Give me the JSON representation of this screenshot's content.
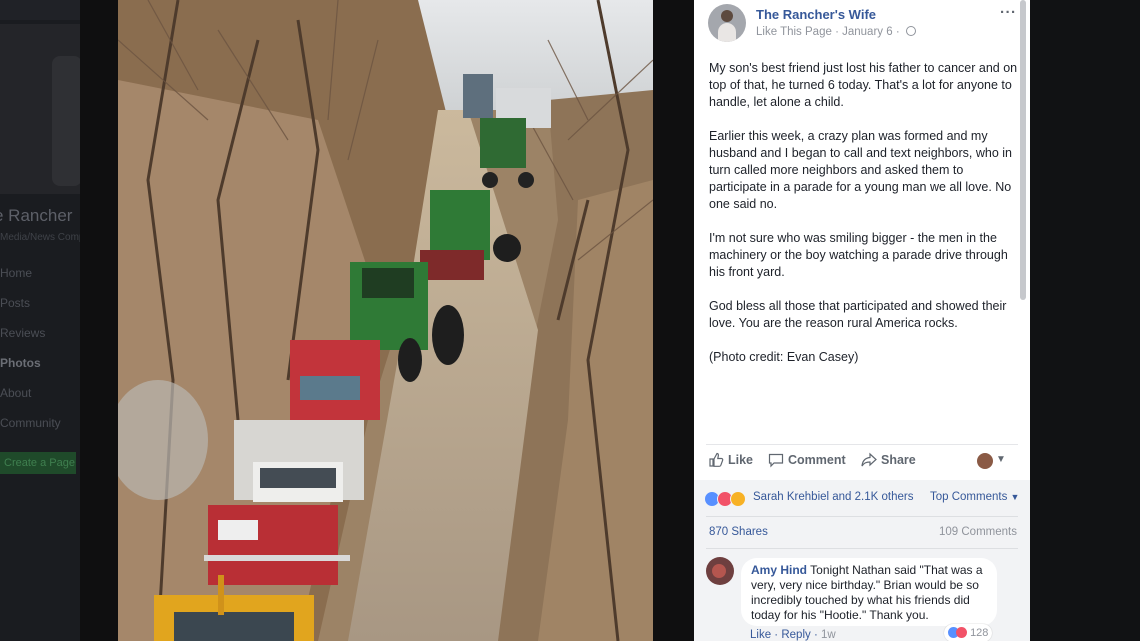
{
  "background": {
    "page_name_partial": "e Rancher",
    "page_sub": "Media/News Company",
    "nav_items": [
      "Home",
      "Posts",
      "Reviews",
      "Photos",
      "About",
      "Community"
    ],
    "cta_partial": "Create a Page"
  },
  "post": {
    "author": "The Rancher's Wife",
    "like_page": "Like This Page",
    "date": "January 6",
    "more_icon": "more-dots-icon",
    "paragraphs": [
      "My son's best friend just lost his father to cancer and on top of that, he turned 6 today. That's a lot for anyone to handle, let alone a child.",
      "Earlier this week, a crazy plan was formed and my husband and I began to call and text neighbors, who in turn called more neighbors and asked them to participate in a parade for a young man we all love. No one said no.",
      "I'm not sure who was smiling bigger - the men in the machinery or the boy watching a parade drive through his front yard.",
      "God bless all those that participated and showed their love. You are the reason rural America rocks.",
      "(Photo credit: Evan Casey)"
    ]
  },
  "actions": {
    "like": "Like",
    "comment": "Comment",
    "share": "Share"
  },
  "reactions": {
    "summary": "Sarah Krehbiel and 2.1K others",
    "top_comments": "Top Comments",
    "shares": "870 Shares",
    "comments": "109 Comments",
    "colors": {
      "like": "#5890ff",
      "love": "#f25268",
      "haha": "#f7b125"
    }
  },
  "comment": {
    "author": "Amy Hind",
    "text": "Tonight Nathan said \"That was a very, very nice birthday.\" Brian would be so incredibly touched by what his friends did today for his \"Hootie.\" Thank you.",
    "like": "Like",
    "reply": "Reply",
    "time": "1w",
    "reaction_count": "128"
  },
  "colors": {
    "link": "#365899",
    "muted": "#90949c",
    "text": "#1d2129",
    "tractor_green": "#2f7a36",
    "truck_red": "#c2343b"
  }
}
